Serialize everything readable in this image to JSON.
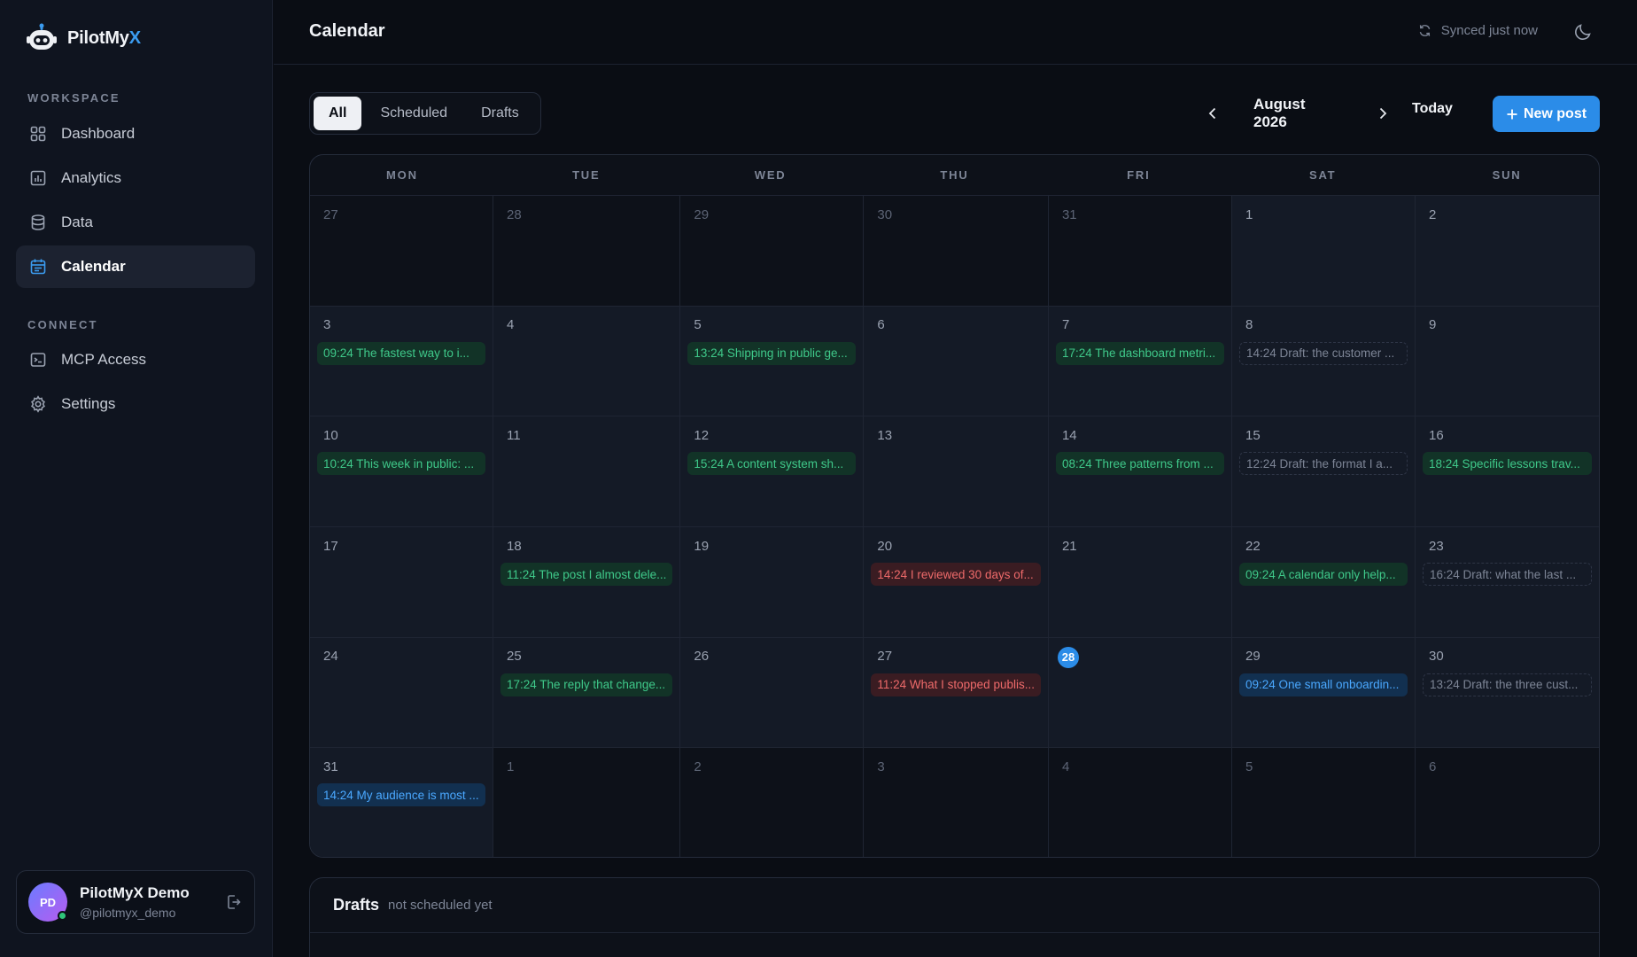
{
  "brand": {
    "name_main": "PilotMy",
    "name_accent": "X"
  },
  "sidebar": {
    "workspace_label": "WORKSPACE",
    "connect_label": "CONNECT",
    "workspace_items": [
      {
        "label": "Dashboard",
        "icon": "grid-icon"
      },
      {
        "label": "Analytics",
        "icon": "bar-chart-icon"
      },
      {
        "label": "Data",
        "icon": "database-icon"
      },
      {
        "label": "Calendar",
        "icon": "calendar-icon",
        "active": true
      }
    ],
    "connect_items": [
      {
        "label": "MCP Access",
        "icon": "terminal-icon"
      },
      {
        "label": "Settings",
        "icon": "gear-icon"
      }
    ]
  },
  "user": {
    "initials": "PD",
    "name": "PilotMyX Demo",
    "handle": "@pilotmyx_demo"
  },
  "header": {
    "title": "Calendar",
    "sync_status": "Synced just now"
  },
  "toolbar": {
    "filters": [
      {
        "label": "All",
        "active": true
      },
      {
        "label": "Scheduled"
      },
      {
        "label": "Drafts"
      }
    ],
    "month": "August 2026",
    "today_label": "Today",
    "new_post_label": "New post"
  },
  "calendar": {
    "weekdays": [
      "MON",
      "TUE",
      "WED",
      "THU",
      "FRI",
      "SAT",
      "SUN"
    ],
    "days": [
      {
        "day": "27",
        "outside": true
      },
      {
        "day": "28",
        "outside": true
      },
      {
        "day": "29",
        "outside": true
      },
      {
        "day": "30",
        "outside": true
      },
      {
        "day": "31",
        "outside": true
      },
      {
        "day": "1"
      },
      {
        "day": "2"
      },
      {
        "day": "3",
        "event": {
          "text": "09:24 The fastest way to i...",
          "status": "green"
        }
      },
      {
        "day": "4"
      },
      {
        "day": "5",
        "event": {
          "text": "13:24 Shipping in public ge...",
          "status": "green"
        }
      },
      {
        "day": "6"
      },
      {
        "day": "7",
        "event": {
          "text": "17:24 The dashboard metri...",
          "status": "green"
        }
      },
      {
        "day": "8",
        "event": {
          "text": "14:24 Draft: the customer ...",
          "status": "draft"
        }
      },
      {
        "day": "9"
      },
      {
        "day": "10",
        "event": {
          "text": "10:24 This week in public: ...",
          "status": "green"
        }
      },
      {
        "day": "11"
      },
      {
        "day": "12",
        "event": {
          "text": "15:24 A content system sh...",
          "status": "green"
        }
      },
      {
        "day": "13"
      },
      {
        "day": "14",
        "event": {
          "text": "08:24 Three patterns from ...",
          "status": "green"
        }
      },
      {
        "day": "15",
        "event": {
          "text": "12:24 Draft: the format I a...",
          "status": "draft"
        }
      },
      {
        "day": "16",
        "event": {
          "text": "18:24 Specific lessons trav...",
          "status": "green"
        }
      },
      {
        "day": "17"
      },
      {
        "day": "18",
        "event": {
          "text": "11:24 The post I almost dele...",
          "status": "green"
        }
      },
      {
        "day": "19"
      },
      {
        "day": "20",
        "event": {
          "text": "14:24 I reviewed 30 days of...",
          "status": "red"
        }
      },
      {
        "day": "21"
      },
      {
        "day": "22",
        "event": {
          "text": "09:24 A calendar only help...",
          "status": "green"
        }
      },
      {
        "day": "23",
        "event": {
          "text": "16:24 Draft: what the last ...",
          "status": "draft"
        }
      },
      {
        "day": "24"
      },
      {
        "day": "25",
        "event": {
          "text": "17:24 The reply that change...",
          "status": "green"
        }
      },
      {
        "day": "26"
      },
      {
        "day": "27",
        "event": {
          "text": "11:24 What I stopped publis...",
          "status": "red"
        }
      },
      {
        "day": "28",
        "today": true
      },
      {
        "day": "29",
        "event": {
          "text": "09:24 One small onboardin...",
          "status": "blue"
        }
      },
      {
        "day": "30",
        "event": {
          "text": "13:24 Draft: the three cust...",
          "status": "draft"
        }
      },
      {
        "day": "31",
        "event": {
          "text": "14:24 My audience is most ...",
          "status": "blue"
        }
      },
      {
        "day": "1",
        "outside": true
      },
      {
        "day": "2",
        "outside": true
      },
      {
        "day": "3",
        "outside": true
      },
      {
        "day": "4",
        "outside": true
      },
      {
        "day": "5",
        "outside": true
      },
      {
        "day": "6",
        "outside": true
      }
    ]
  },
  "drafts": {
    "title": "Drafts",
    "subtitle": "not scheduled yet"
  },
  "colors": {
    "accent": "#2b8ce8",
    "published": "#3fc98a",
    "failed": "#ee6a6a",
    "scheduled": "#4aa8ff"
  }
}
